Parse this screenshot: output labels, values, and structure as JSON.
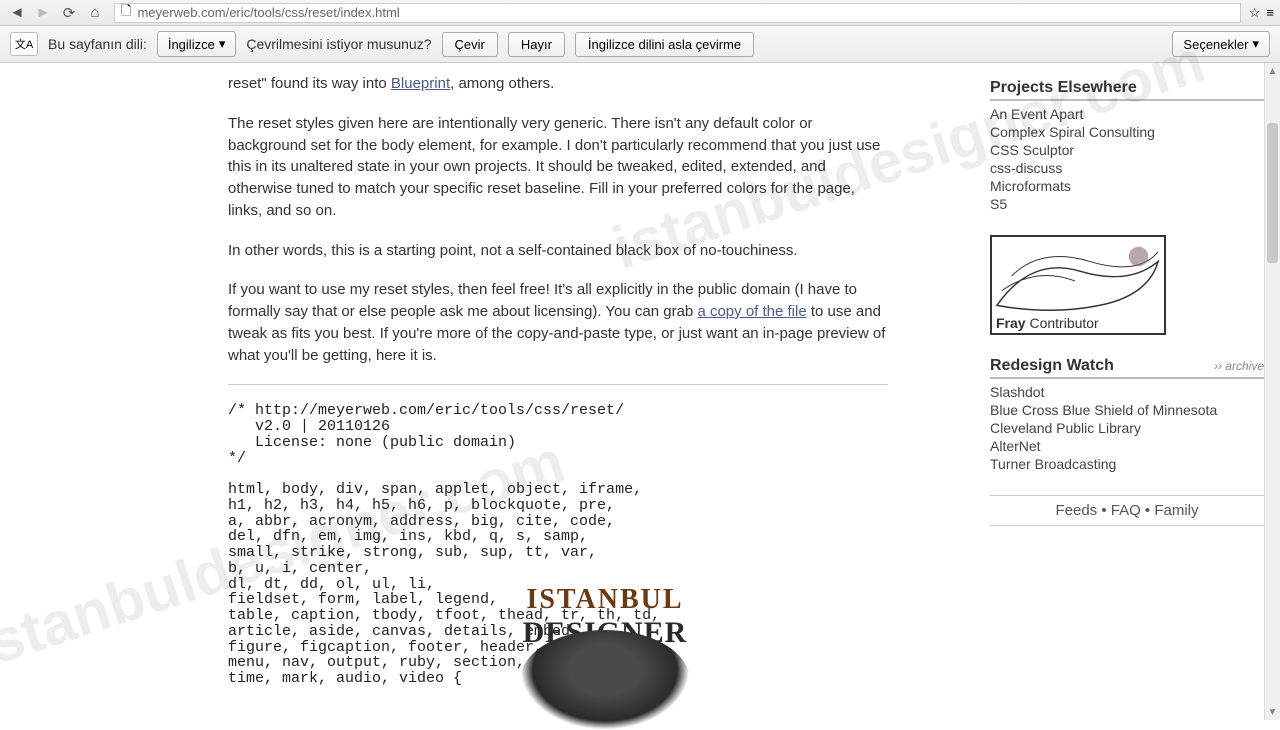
{
  "browser": {
    "url": "meyerweb.com/eric/tools/css/reset/index.html"
  },
  "translate": {
    "page_lang_label": "Bu sayfanın dili:",
    "lang_value": "İngilizce",
    "question": "Çevrilmesini istiyor musunuz?",
    "btn_translate": "Çevir",
    "btn_no": "Hayır",
    "btn_never": "İngilizce dilini asla çevirme",
    "options": "Seçenekler"
  },
  "content": {
    "p1_prefix": "reset\" found its way into ",
    "p1_link": "Blueprint",
    "p1_suffix": ", among others.",
    "p2": "The reset styles given here are intentionally very generic. There isn't any default color or background set for the body element, for example. I don't particularly recommend that you just use this in its unaltered state in your own projects. It should be tweaked, edited, extended, and otherwise tuned to match your specific reset baseline. Fill in your preferred colors for the page, links, and so on.",
    "p3": "In other words, this is a starting point, not a self-contained black box of no-touchiness.",
    "p4_a": "If you want to use my reset styles, then feel free! It's all explicitly in the public domain (I have to formally say that or else people ask me about licensing). You can grab ",
    "p4_link": "a copy of the file",
    "p4_b": " to use and tweak as fits you best. If you're more of the copy-and-paste type, or just want an in-page preview of what you'll be getting, here it is.",
    "code": "/* http://meyerweb.com/eric/tools/css/reset/\n   v2.0 | 20110126\n   License: none (public domain)\n*/\n\nhtml, body, div, span, applet, object, iframe,\nh1, h2, h3, h4, h5, h6, p, blockquote, pre,\na, abbr, acronym, address, big, cite, code,\ndel, dfn, em, img, ins, kbd, q, s, samp,\nsmall, strike, strong, sub, sup, tt, var,\nb, u, i, center,\ndl, dt, dd, ol, ul, li,\nfieldset, form, label, legend,\ntable, caption, tbody, tfoot, thead, tr, th, td,\narticle, aside, canvas, details, embed,\nfigure, figcaption, footer, header, hgroup,\nmenu, nav, output, ruby, section, summary,\ntime, mark, audio, video {"
  },
  "sidebar": {
    "projects_title": "Projects Elsewhere",
    "projects": [
      "An Event Apart",
      "Complex Spiral Consulting",
      "CSS Sculptor",
      "css-discuss",
      "Microformats",
      "S5"
    ],
    "fray_bold": "Fray",
    "fray_rest": " Contributor",
    "redesign_title": "Redesign Watch",
    "archive": "›› archive",
    "redesign": [
      "Slashdot",
      "Blue Cross Blue Shield of Minnesota",
      "Cleveland Public Library",
      "AlterNet",
      "Turner Broadcasting"
    ],
    "footer": "Feeds  •  FAQ  •  Family"
  },
  "overlay": {
    "watermark": "istanbuldesigner.com",
    "logo1": "ISTANBUL",
    "logo2": "DESIGNER"
  }
}
